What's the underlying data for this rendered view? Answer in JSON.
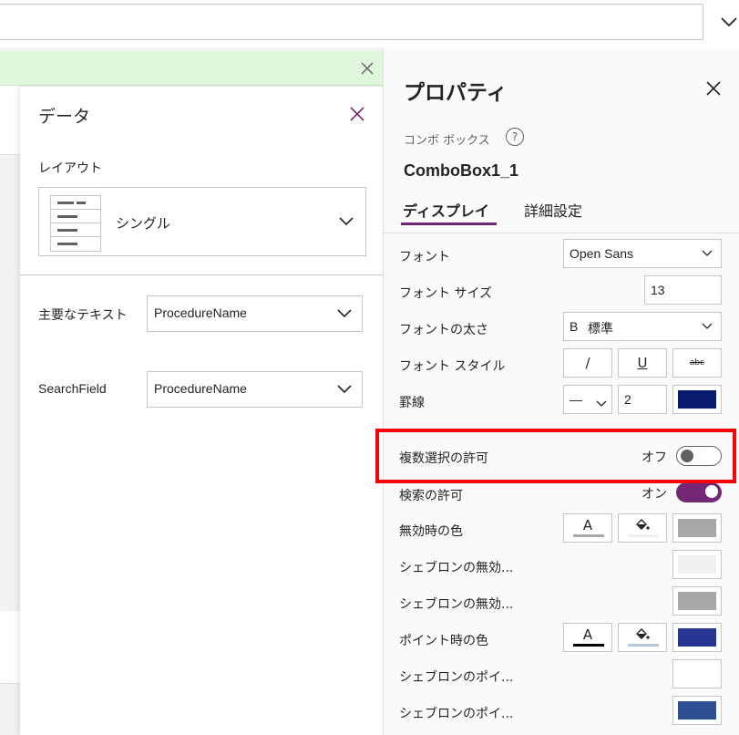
{
  "colors": {
    "accent": "#742774",
    "highlight": "#ff0000",
    "notice_bg": "#dff6dd",
    "border_color": "#0b1b6e",
    "disabled_color": "#a8a8a8",
    "chevron_disabled_1": "#f0f0f0",
    "chevron_disabled_2": "#a8a8a8",
    "hover_color": "#283593",
    "chevron_hover_1": "#ffffff",
    "chevron_hover_2": "#2f4f93"
  },
  "formula_bar": {
    "dropdown_icon": "chevron-down-icon"
  },
  "notice": {
    "close_icon": "close-icon"
  },
  "data_pane": {
    "title": "データ",
    "close_icon": "close-icon",
    "layout_label": "レイアウト",
    "layout_value": "シングル",
    "fields": [
      {
        "label": "主要なテキスト",
        "value": "ProcedureName"
      },
      {
        "label": "SearchField",
        "value": "ProcedureName"
      }
    ]
  },
  "properties": {
    "title": "プロパティ",
    "control_type": "コンボ ボックス",
    "help_glyph": "?",
    "control_name": "ComboBox1_1",
    "tabs": [
      {
        "label": "ディスプレイ",
        "active": true
      },
      {
        "label": "詳細設定",
        "active": false
      }
    ],
    "font": {
      "label": "フォント",
      "value": "Open Sans"
    },
    "font_size": {
      "label": "フォント サイズ",
      "value": "13"
    },
    "font_weight": {
      "label": "フォントの太さ",
      "prefix": "B",
      "value": "標準"
    },
    "font_style": {
      "label": "フォント スタイル",
      "italic": "/",
      "underline": "U",
      "strike": "abc"
    },
    "border": {
      "label": "罫線",
      "style_glyph": "—",
      "width": "2"
    },
    "multi_select": {
      "label": "複数選択の許可",
      "state": "オフ",
      "on": false
    },
    "search": {
      "label": "検索の許可",
      "state": "オン",
      "on": true
    },
    "disabled_color": {
      "label": "無効時の色",
      "text_glyph": "A"
    },
    "chevron_disabled_1": {
      "label": "シェブロンの無効..."
    },
    "chevron_disabled_2": {
      "label": "シェブロンの無効..."
    },
    "hover_color": {
      "label": "ポイント時の色",
      "text_glyph": "A"
    },
    "chevron_hover_1": {
      "label": "シェブロンのポイ..."
    },
    "chevron_hover_2": {
      "label": "シェブロンのポイ..."
    }
  }
}
